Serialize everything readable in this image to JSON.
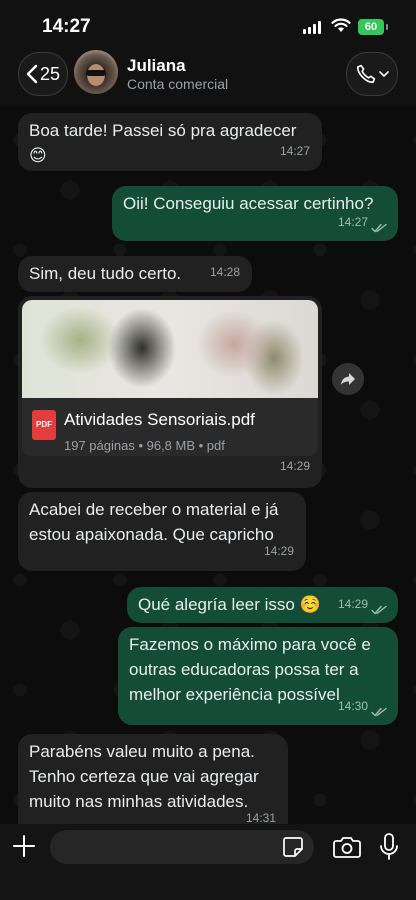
{
  "status_bar": {
    "time": "14:27",
    "battery": "60",
    "colors": {
      "battery": "#34c759"
    }
  },
  "header": {
    "back_count": "25",
    "contact_name": "Juliana",
    "contact_subtitle": "Conta comercial"
  },
  "messages": [
    {
      "direction": "incoming",
      "lines": [
        "Boa tarde! Passei só pra agradecer",
        "😊"
      ],
      "time": "14:27"
    },
    {
      "direction": "outgoing",
      "lines": [
        "Oii! Conseguiu acessar certinho?"
      ],
      "time": "14:27",
      "status": "read"
    },
    {
      "direction": "incoming",
      "lines": [
        "Sim, deu tudo certo."
      ],
      "time": "14:28"
    },
    {
      "direction": "incoming",
      "type": "document",
      "file_name": "Atividades Sensoriais.pdf",
      "file_meta": "197 páginas • 96,8 MB • pdf",
      "file_badge": "PDF",
      "time": "14:29"
    },
    {
      "direction": "incoming",
      "lines": [
        "Acabei de receber o material e já",
        "estou apaixonada. Que capricho"
      ],
      "time": "14:29"
    },
    {
      "direction": "outgoing",
      "lines": [
        "Qué alegría leer isso ☺️"
      ],
      "time": "14:29",
      "status": "read"
    },
    {
      "direction": "outgoing",
      "lines": [
        "Fazemos o máximo para você e",
        "outras educadoras possa ter a",
        "melhor experiência possível"
      ],
      "time": "14:30",
      "status": "read"
    },
    {
      "direction": "incoming",
      "lines": [
        "Parabéns valeu muito a pena.",
        "Tenho certeza que vai agregar",
        "muito nas minhas atividades."
      ],
      "time": "14:31"
    }
  ],
  "input": {
    "placeholder": ""
  },
  "colors": {
    "incoming_bubble": "#212121",
    "outgoing_bubble": "#134d37",
    "background": "#0c0c0c",
    "read_ticks": "#9fbdb0"
  },
  "icons": [
    "back-chevron-icon",
    "phone-icon",
    "chevron-down-icon",
    "pdf-icon",
    "forward-icon",
    "plus-icon",
    "sticker-icon",
    "camera-icon",
    "mic-icon",
    "double-check-icon",
    "signal-icon",
    "wifi-icon",
    "battery-icon"
  ]
}
